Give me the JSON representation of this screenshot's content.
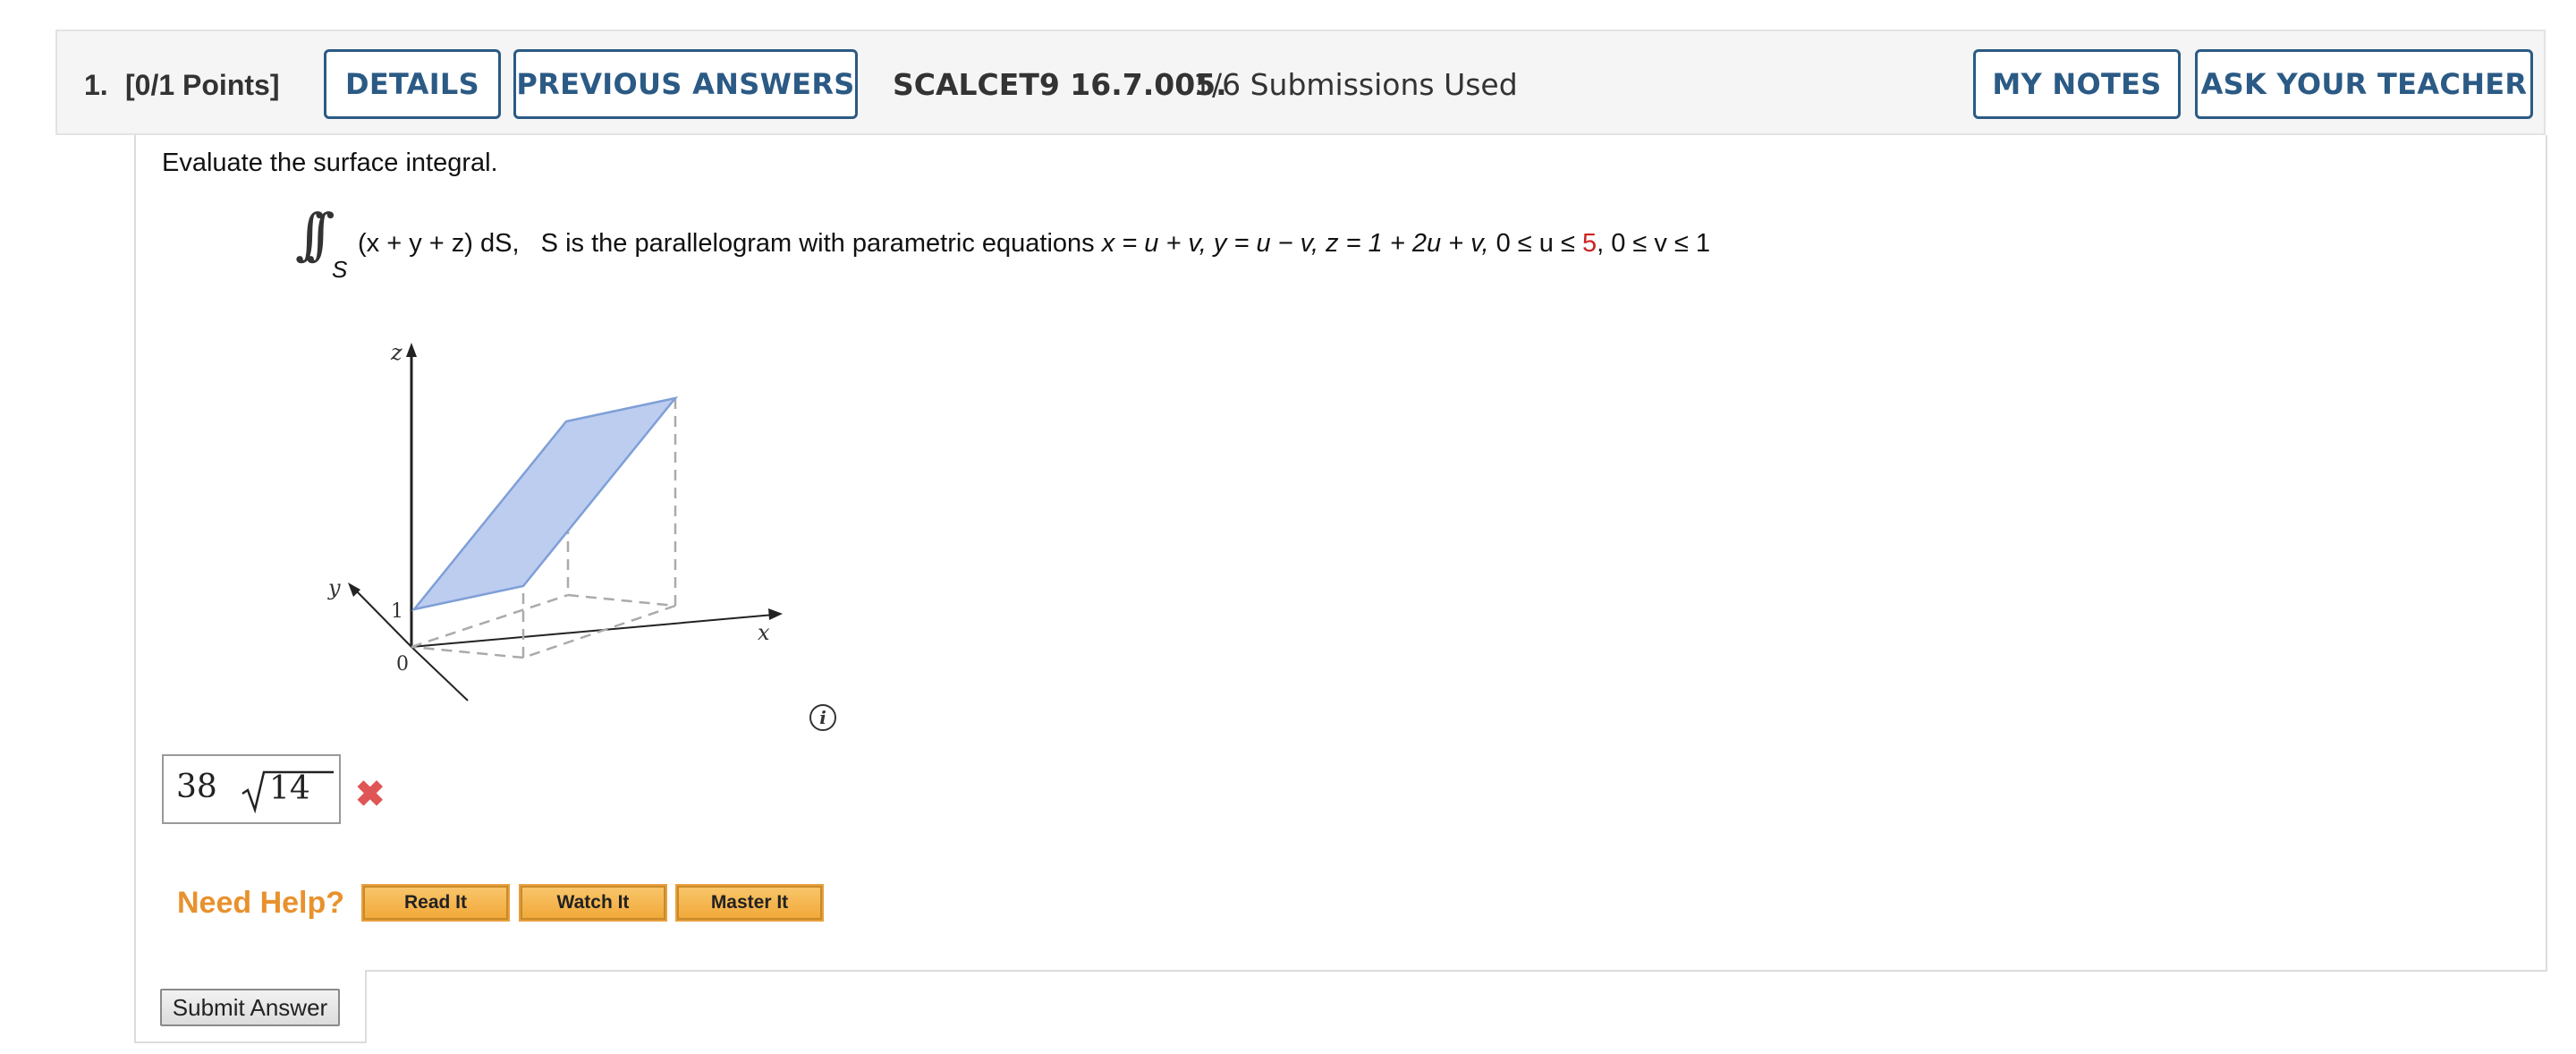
{
  "header": {
    "number": "1.",
    "points": "[0/1 Points]",
    "details_label": "DETAILS",
    "previous_answers_label": "PREVIOUS ANSWERS",
    "question_code": "SCALCET9 16.7.005.",
    "submissions": "1/6 Submissions Used",
    "my_notes_label": "MY NOTES",
    "ask_teacher_label": "ASK YOUR TEACHER"
  },
  "question": {
    "prompt": "Evaluate the surface integral.",
    "integral_symbol": "∫∫",
    "integral_subscript": "S",
    "integrand": "(x + y + z) dS,",
    "surface_desc": "S is the parallelogram with parametric equations",
    "param_x": "x = u + v,",
    "param_y": "y = u − v,",
    "param_z": "z = 1 + 2u + v,",
    "u_range_start": "0 ≤ u ≤",
    "u_upper": "5",
    "v_range": ", 0 ≤ v ≤ 1",
    "highlight_color": "#cc2222"
  },
  "figure": {
    "z_label": "z",
    "y_label": "y",
    "x_label": "x",
    "one_label": "1",
    "zero_label": "0",
    "surface_fill": "#bccdf0",
    "surface_stroke": "#7f9fd6"
  },
  "info_icon": "info-icon",
  "answer": {
    "coefficient": "38",
    "radicand": "14",
    "status_icon": "wrong-x-icon",
    "status_symbol": "✖"
  },
  "help": {
    "need_help_label": "Need Help?",
    "read_it_label": "Read It",
    "watch_it_label": "Watch It",
    "master_it_label": "Master It",
    "accent": "#e8912d"
  },
  "submit_label": "Submit Answer"
}
